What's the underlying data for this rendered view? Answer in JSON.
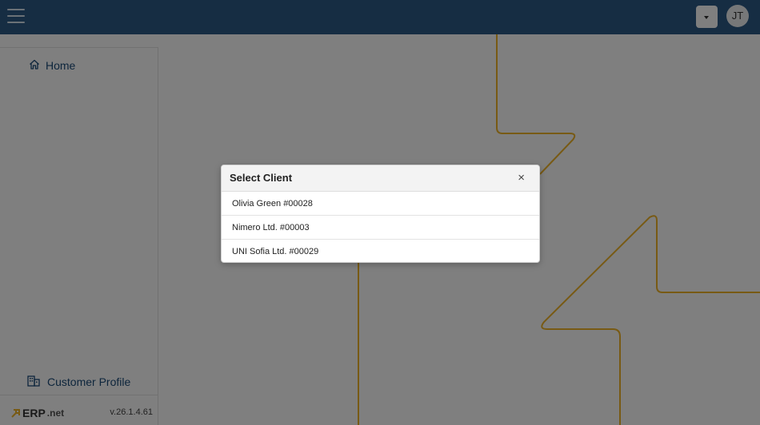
{
  "header": {
    "menu_icon": "hamburger-icon",
    "dropdown_icon": "caret-down-icon",
    "avatar_initials": "JT"
  },
  "sidebar": {
    "home": {
      "label": "Home",
      "icon": "home-icon"
    },
    "customer_profile": {
      "label": "Customer Profile",
      "icon": "building-icon"
    },
    "logo": {
      "text": "ERP",
      "suffix": ".net"
    },
    "version": "v.26.1.4.61"
  },
  "modal": {
    "title": "Select Client",
    "close_label": "×",
    "clients": [
      {
        "label": "Olivia Green #00028"
      },
      {
        "label": "Nimero Ltd. #00003"
      },
      {
        "label": "UNI Sofia Ltd. #00029"
      }
    ]
  },
  "colors": {
    "topbar": "#2c5a86",
    "accent_line": "#f0b429",
    "link": "#1a4a78"
  }
}
